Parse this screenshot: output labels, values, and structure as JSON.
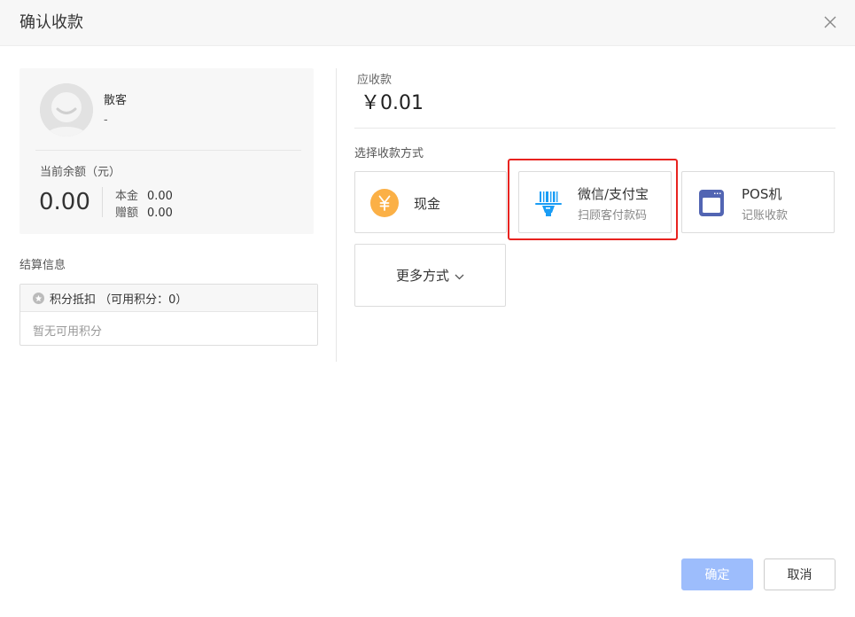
{
  "dialog": {
    "title": "确认收款"
  },
  "customer": {
    "name": "散客",
    "phone": "-",
    "balance_label": "当前余额（元）",
    "balance_value": "0.00",
    "principal_label": "本金",
    "principal_value": "0.00",
    "bonus_label": "赠额",
    "bonus_value": "0.00"
  },
  "settlement": {
    "title": "结算信息",
    "points_label": "积分抵扣 （可用积分：0）",
    "points_empty": "暂无可用积分"
  },
  "payment": {
    "due_label": "应收款",
    "due_value": "￥0.01",
    "method_title": "选择收款方式",
    "methods": [
      {
        "title": "现金",
        "subtitle": "",
        "icon": "yuan-coin-icon"
      },
      {
        "title": "微信/支付宝",
        "subtitle": "扫顾客付款码",
        "icon": "barcode-scanner-icon"
      },
      {
        "title": "POS机",
        "subtitle": "记账收款",
        "icon": "pos-terminal-icon"
      }
    ],
    "more_label": "更多方式"
  },
  "buttons": {
    "confirm": "确定",
    "cancel": "取消"
  },
  "colors": {
    "accent_disabled": "#9dbdfc",
    "cash_icon": "#fbb046",
    "scan_icon": "#1a9df5",
    "pos_icon": "#5265b3",
    "highlight": "#e8231f"
  }
}
